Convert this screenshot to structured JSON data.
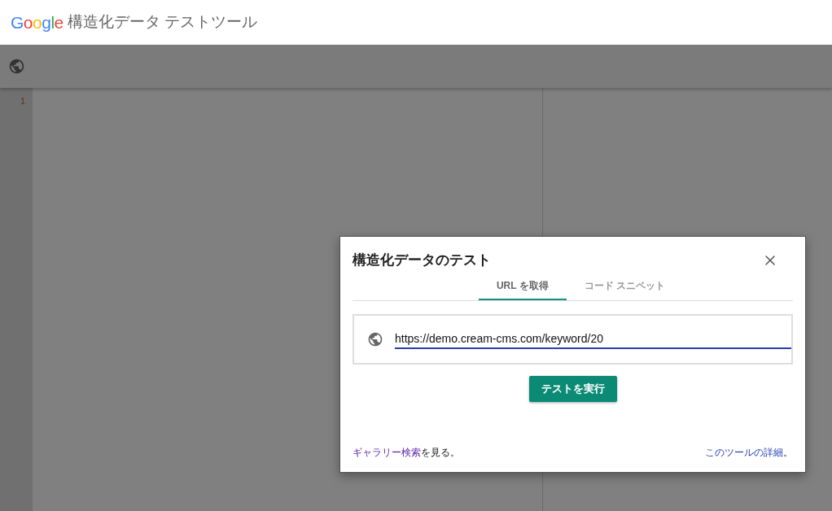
{
  "header": {
    "logo": "Google",
    "title": "構造化データ テストツール"
  },
  "editor": {
    "line_numbers": [
      "1"
    ]
  },
  "dialog": {
    "title": "構造化データのテスト",
    "tabs": [
      {
        "label": "URL を取得",
        "selected": true
      },
      {
        "label": "コード スニペット",
        "selected": false
      }
    ],
    "url_field": {
      "value": "https://demo.cream-cms.com/keyword/20"
    },
    "run_button": "テストを実行",
    "footer_left": {
      "link": "ギャラリー検索",
      "text": "を見る。"
    },
    "footer_right": {
      "link": "このツールの詳細",
      "text": "。"
    }
  }
}
